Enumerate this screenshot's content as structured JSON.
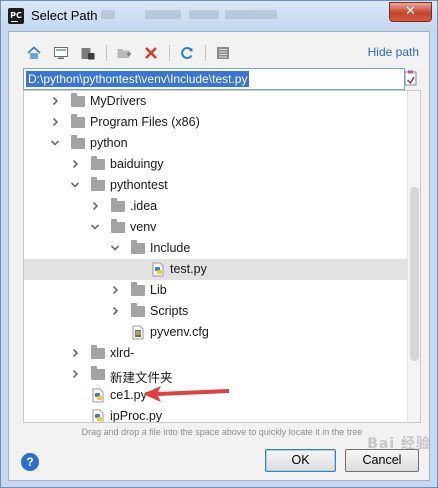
{
  "window": {
    "title": "Select Path",
    "app_icon_text": "PC",
    "close_glyph": "✕"
  },
  "toolbar": {
    "buttons": [
      "home-icon",
      "desktop-icon",
      "project-icon",
      "new-folder-icon",
      "delete-icon",
      "refresh-icon",
      "show-hidden-icon"
    ],
    "hide_path_label": "Hide path"
  },
  "path": {
    "value": "D:\\python\\pythontest\\venv\\Include\\test.py"
  },
  "tree": {
    "items": [
      {
        "label": "MyDrivers",
        "type": "folder",
        "depth": 0,
        "expanded": false,
        "selected": false
      },
      {
        "label": "Program Files (x86)",
        "type": "folder",
        "depth": 0,
        "expanded": false,
        "selected": false
      },
      {
        "label": "python",
        "type": "folder",
        "depth": 0,
        "expanded": true,
        "selected": false
      },
      {
        "label": "baiduingy",
        "type": "folder",
        "depth": 1,
        "expanded": false,
        "selected": false
      },
      {
        "label": "pythontest",
        "type": "folder",
        "depth": 1,
        "expanded": true,
        "selected": false
      },
      {
        "label": ".idea",
        "type": "folder",
        "depth": 2,
        "expanded": false,
        "selected": false
      },
      {
        "label": "venv",
        "type": "folder",
        "depth": 2,
        "expanded": true,
        "selected": false
      },
      {
        "label": "Include",
        "type": "folder",
        "depth": 3,
        "expanded": true,
        "selected": false
      },
      {
        "label": "test.py",
        "type": "python",
        "depth": 4,
        "expanded": null,
        "selected": true
      },
      {
        "label": "Lib",
        "type": "folder",
        "depth": 3,
        "expanded": false,
        "selected": false
      },
      {
        "label": "Scripts",
        "type": "folder",
        "depth": 3,
        "expanded": false,
        "selected": false
      },
      {
        "label": "pyvenv.cfg",
        "type": "config",
        "depth": 3,
        "expanded": null,
        "selected": false
      },
      {
        "label": "xlrd-",
        "type": "folder",
        "depth": 1,
        "expanded": false,
        "selected": false
      },
      {
        "label": "新建文件夹",
        "type": "folder",
        "depth": 1,
        "expanded": false,
        "selected": false
      },
      {
        "label": "ce1.py",
        "type": "python",
        "depth": 1,
        "expanded": null,
        "selected": false
      },
      {
        "label": "ipProc.py",
        "type": "python",
        "depth": 1,
        "expanded": null,
        "selected": false
      }
    ]
  },
  "hint": "Drag and drop a file into the space above to quickly locate it in the tree",
  "buttons": {
    "help": "?",
    "ok": "OK",
    "cancel": "Cancel"
  },
  "colors": {
    "accent": "#2c6cb8",
    "selection": "#3875d7",
    "arrow": "#e0403f",
    "selected_row": "#e2e2e2"
  }
}
